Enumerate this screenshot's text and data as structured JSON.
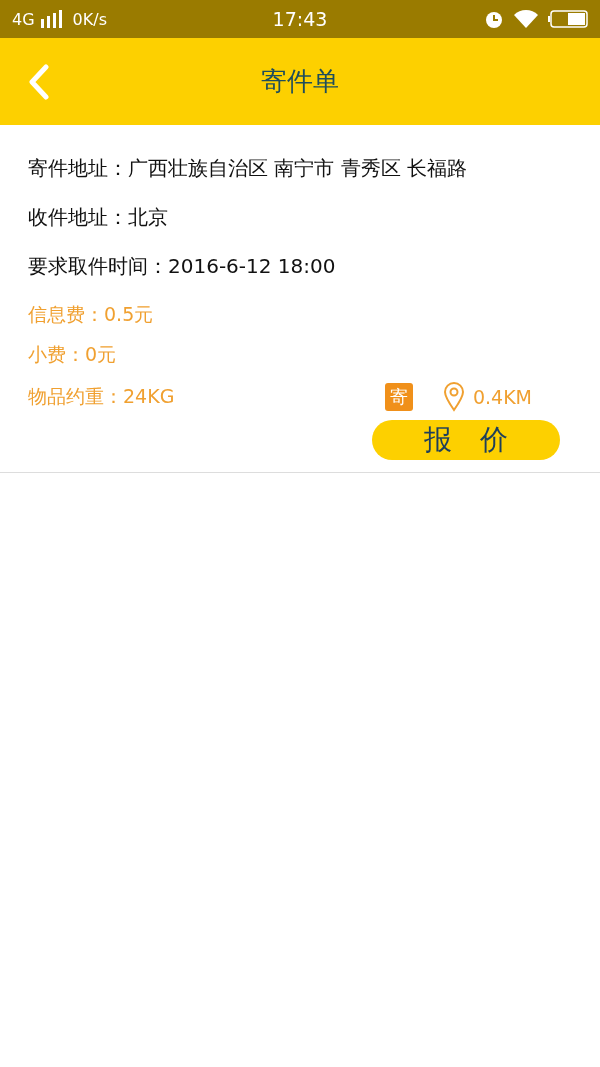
{
  "status_bar": {
    "network": "4G",
    "speed": "0K/s",
    "time": "17:43"
  },
  "header": {
    "title": "寄件单"
  },
  "order": {
    "fields": [
      {
        "kind": "primary",
        "label": "寄件地址：",
        "value": "广西壮族自治区 南宁市 青秀区 长福路"
      },
      {
        "kind": "primary",
        "label": "收件地址：",
        "value": "北京"
      },
      {
        "kind": "primary",
        "label": "要求取件时间：",
        "value": "2016-6-12 18:00"
      },
      {
        "kind": "accent",
        "label": "信息费：",
        "value": "0.5元"
      },
      {
        "kind": "accent",
        "label": "小费：",
        "value": "0元"
      }
    ],
    "weight": {
      "label": "物品约重：",
      "value": "24KG"
    },
    "badge": "寄",
    "distance": "0.4KM",
    "quote_button": "报　价"
  }
}
